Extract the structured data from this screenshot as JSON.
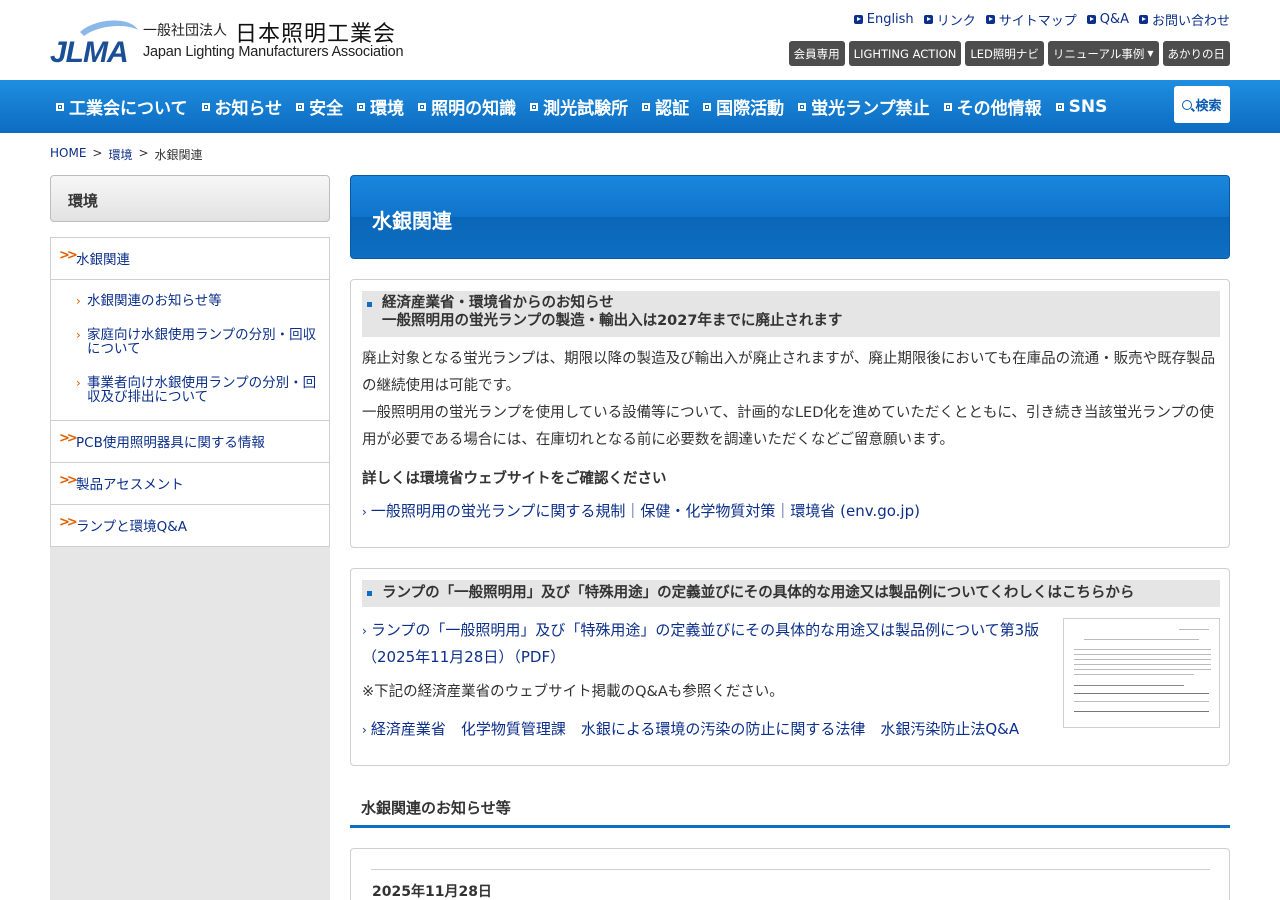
{
  "header": {
    "logo_mark": "JLMA",
    "logo_sub": "一般社団法人",
    "logo_main": "日本照明工業会",
    "logo_en": "Japan Lighting Manufacturers Association",
    "top_links": [
      "English",
      "リンク",
      "サイトマップ",
      "Q&A",
      "お問い合わせ"
    ],
    "top_buttons": [
      "会員専用",
      "LIGHTING ACTION",
      "LED照明ナビ",
      "リニューアル事例",
      "あかりの日"
    ],
    "colors": {
      "brand": "#0d6ec2",
      "dark_button": "#4d4d4d",
      "accent_arrow": "#e06000"
    }
  },
  "gnav": {
    "items": [
      "工業会について",
      "お知らせ",
      "安全",
      "環境",
      "照明の知識",
      "測光試験所",
      "認証",
      "国際活動",
      "蛍光ランプ禁止",
      "その他情報",
      "SNS"
    ],
    "search_label": "検索"
  },
  "breadcrumb": {
    "home": "HOME",
    "sep": ">",
    "level1": "環境",
    "current": "水銀関連"
  },
  "sidebar": {
    "title": "環境",
    "items": [
      {
        "label": "水銀関連"
      },
      {
        "label": "PCB使用照明器具に関する情報"
      },
      {
        "label": "製品アセスメント"
      },
      {
        "label": "ランプと環境Q&A"
      }
    ],
    "sub_items": [
      "水銀関連のお知らせ等",
      "家庭向け水銀使用ランプの分別・回収について",
      "事業者向け水銀使用ランプの分別・回収及び排出について"
    ]
  },
  "main": {
    "page_title": "水銀関連",
    "box1": {
      "head_line1": "経済産業省・環境省からのお知らせ",
      "head_line2": "一般照明用の蛍光ランプの製造・輸出入は2027年までに廃止されます",
      "para1": "廃止対象となる蛍光ランプは、期限以降の製造及び輸出入が廃止されますが、廃止期限後においても在庫品の流通・販売や既存製品の継続使用は可能です。",
      "para2": "一般照明用の蛍光ランプを使用している設備等について、計画的なLED化を進めていただくとともに、引き続き当該蛍光ランプの使用が必要である場合には、在庫切れとなる前に必要数を調達いただくなどご留意願います。",
      "strong": "詳しくは環境省ウェブサイトをご確認ください",
      "link": "一般照明用の蛍光ランプに関する規制｜保健・化学物質対策｜環境省 (env.go.jp)"
    },
    "box2": {
      "head": "ランプの「一般照明用」及び「特殊用途」の定義並びにその具体的な用途又は製品例についてくわしくはこちらから",
      "link1": "ランプの「一般照明用」及び「特殊用途」の定義並びにその具体的な用途又は製品例について第3版（2025年11月28日）（PDF）",
      "note": "※下記の経済産業省のウェブサイト掲載のQ&Aも参照ください。",
      "link2": "経済産業省　化学物質管理課　水銀による環境の汚染の防止に関する法律　水銀汚染防止法Q&A"
    },
    "section_title": "水銀関連のお知らせ等",
    "news_date": "2025年11月28日"
  }
}
